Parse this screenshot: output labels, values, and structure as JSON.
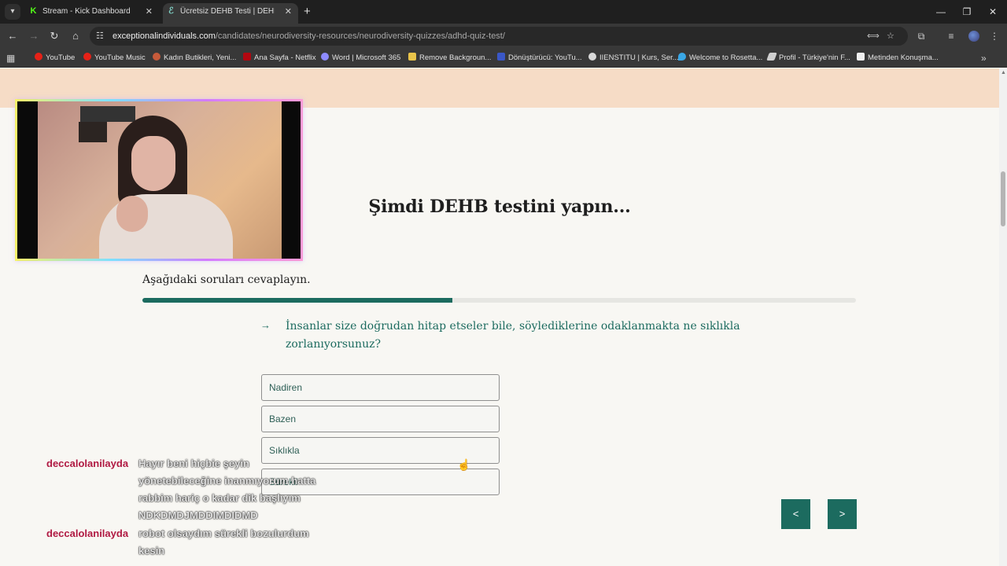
{
  "browser": {
    "tabs": [
      {
        "title": "Stream - Kick Dashboard",
        "favicon": "K",
        "favicon_color": "#53fc18",
        "active": false
      },
      {
        "title": "Ücretsiz DEHB Testi | DEHB'im V",
        "favicon": "ℰ",
        "favicon_color": "#7fd0c4",
        "active": true
      }
    ],
    "new_tab": "+",
    "url_domain": "exceptionalindividuals.com",
    "url_path": "/candidates/neurodiversity-resources/neurodiversity-quizzes/adhd-quiz-test/",
    "bookmarks": [
      {
        "label": "YouTube",
        "color": "#e62117"
      },
      {
        "label": "YouTube Music",
        "color": "#e62117"
      },
      {
        "label": "Kadın Butikleri, Yeni...",
        "color": "#c65a3a"
      },
      {
        "label": "Ana Sayfa - Netflix",
        "color": "#b20710"
      },
      {
        "label": "Word | Microsoft 365",
        "color": "#8e8bff"
      },
      {
        "label": "Remove Backgroun...",
        "color": "#e9c44a"
      },
      {
        "label": "Dönüştürücü: YouTu...",
        "color": "#3a57c7"
      },
      {
        "label": "IIENSTITU | Kurs, Ser...",
        "color": "#d8d8d8"
      },
      {
        "label": "Welcome to Rosetta...",
        "color": "#3aa7e6"
      },
      {
        "label": "Profil - Türkiye'nin F...",
        "color": "#cfcfcf"
      },
      {
        "label": "Metinden Konuşma...",
        "color": "#f0f0f0"
      }
    ]
  },
  "quiz": {
    "heading": "Şimdi DEHB testini yapın...",
    "instruction": "Aşağıdaki soruları cevaplayın.",
    "progress": 0.434,
    "arrow": "→",
    "question": "İnsanlar size doğrudan hitap etseler bile, söylediklerine odaklanmakta ne sıklıkla zorlanıyorsunuz?",
    "options": [
      "Nadiren",
      "Bazen",
      "Sıklıkla",
      "Sürekli"
    ],
    "prev_label": "<",
    "next_label": ">"
  },
  "chat": [
    {
      "user": "deccalolanilayda",
      "message": "Hayır beni hiçbie şeyin yönetebileceğine inanmıyorum hatta rabbim hariç o kadar dik başlıyım NDKDMDJMDDIMDIDMD"
    },
    {
      "user": "deccalolanilayda",
      "message": "robot olsaydım sürekli bozulurdum kesin"
    }
  ],
  "colors": {
    "accent": "#1c6b5f",
    "peach_banner": "#f6dcc6",
    "chat_user": "#b01942"
  }
}
